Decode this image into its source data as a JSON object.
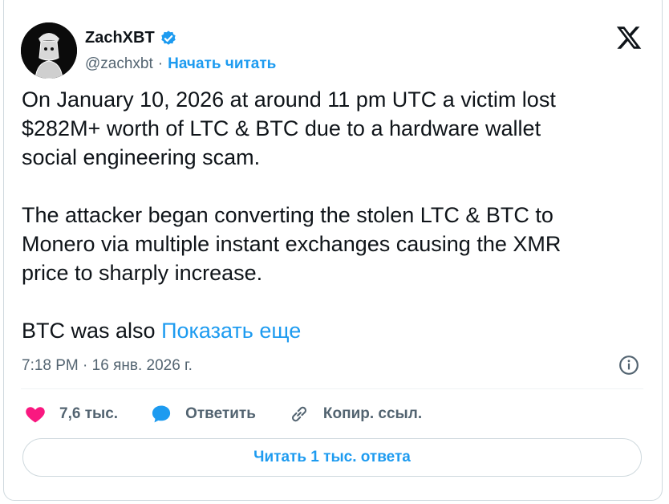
{
  "author": {
    "name": "ZachXBT",
    "handle": "@zachxbt",
    "separator": "·",
    "follow_label": "Начать читать",
    "verified": true,
    "avatar_icon": "detective-avatar-icon",
    "verified_color": "#1d9bf0"
  },
  "platform_logo": "x-logo-icon",
  "tweet": {
    "paragraphs": [
      "On January 10, 2026 at around 11 pm UTC a victim lost\n$282M+ worth of LTC & BTC due to a hardware wallet\nsocial engineering scam.",
      "The attacker began converting the stolen LTC & BTC to\nMonero via multiple instant exchanges causing the XMR\nprice to sharply increase."
    ],
    "last_line": "BTC was also ",
    "show_more_label": "Показать еще"
  },
  "meta": {
    "time": "7:18 PM",
    "separator": " · ",
    "date": "16 янв. 2026 г."
  },
  "actions": {
    "likes": "7,6 тыс.",
    "reply_label": "Ответить",
    "copy_link_label": "Копир. ссыл."
  },
  "read_replies_label": "Читать 1 тыс. ответа",
  "colors": {
    "accent": "#1d9bf0",
    "like": "#f91880",
    "text": "#0f1419",
    "muted": "#536471"
  }
}
